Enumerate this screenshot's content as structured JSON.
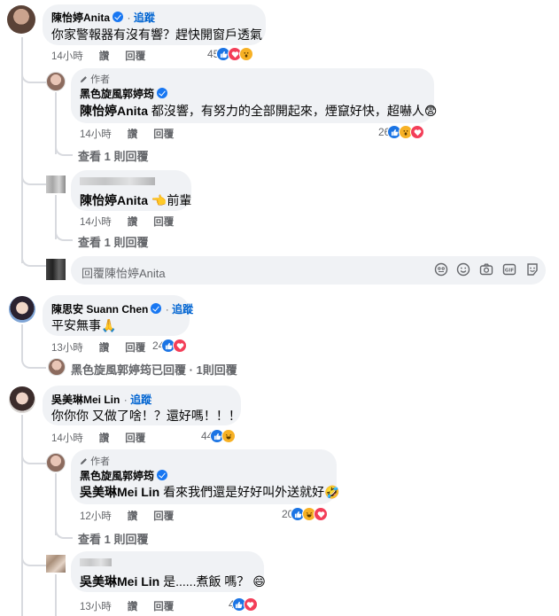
{
  "follow_label": "追蹤",
  "like_label": "讚",
  "reply_label": "回覆",
  "author_badge": "作者",
  "view_one_reply": "查看 1 則回覆",
  "comments": [
    {
      "name": "陳怡婷Anita",
      "text": "你家警報器有沒有響？趕快開窗戶透氣",
      "time": "14小時",
      "reactions": "45",
      "reply": {
        "name": "黑色旋風郭婷筠",
        "mention": "陳怡婷Anita",
        "text": "都沒響，有努力的全部開起來，煙竄好快，超嚇人😨",
        "time": "14小時",
        "reactions": "26"
      },
      "reply2": {
        "mention": "陳怡婷Anita",
        "text": "👈前輩",
        "time": "14小時"
      },
      "composer_placeholder": "回覆陳怡婷Anita"
    },
    {
      "name": "陳思安 Suann Chen",
      "text": "平安無事🙏",
      "time": "13小時",
      "reactions": "24",
      "replied_note": "黑色旋風郭婷筠已回覆 · 1則回覆"
    },
    {
      "name": "吳美琳Mei Lin",
      "text": "你你你 又做了啥！？還好嗎！！！",
      "time": "14小時",
      "reactions": "44",
      "reply": {
        "name": "黑色旋風郭婷筠",
        "mention": "吳美琳Mei Lin",
        "text": "看來我們還是好好叫外送就好🤣",
        "time": "12小時",
        "reactions": "20"
      },
      "reply2": {
        "mention": "吳美琳Mei Lin",
        "text": "是......煮飯 嗎？ 😄",
        "time": "13小時",
        "reactions": "4"
      }
    }
  ],
  "colors": {
    "bubble": "#f0f2f5",
    "link": "#0064d1",
    "meta": "#65676b",
    "like": "#1b74e4",
    "love": "#f33e58",
    "haha": "#f7b125"
  },
  "icons": [
    "verified-icon",
    "pencil-icon",
    "avatar-sticker-icon",
    "emoji-icon",
    "camera-icon",
    "gif-icon",
    "sticker-icon"
  ]
}
